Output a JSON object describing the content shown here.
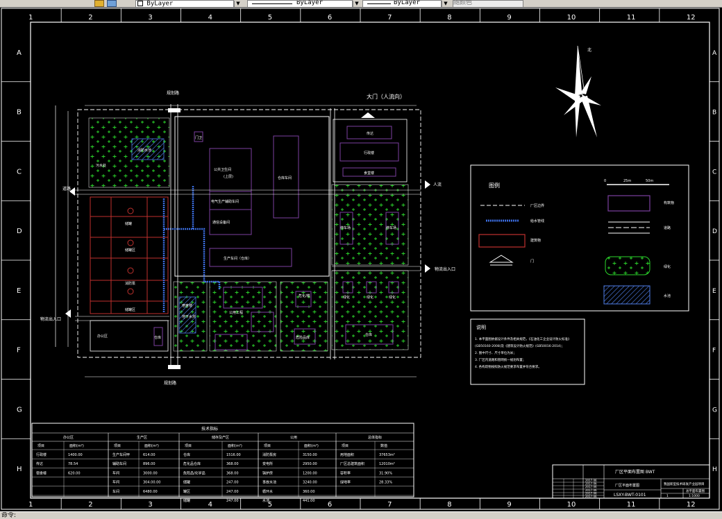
{
  "toolbar": {
    "layer_dropdown_value": "ByLayer",
    "linetype_dropdown_value": "ByLayer",
    "lineweight_dropdown_value": "ByLayer",
    "plotstyle_dropdown_value": "随颜色"
  },
  "frame": {
    "column_labels": [
      "1",
      "2",
      "3",
      "4",
      "5",
      "6",
      "7",
      "8",
      "9",
      "10",
      "11",
      "12"
    ],
    "row_labels": [
      "A",
      "B",
      "C",
      "D",
      "E",
      "F",
      "G",
      "H"
    ]
  },
  "plan": {
    "main_gate_label": "大门（人流向）",
    "north_label": "北",
    "room_labels": {
      "top_left_label": "污水处",
      "pond_label": "消防水池",
      "cinema_label": "公共卫生间",
      "cinema_sub": "(上层)",
      "office1": "电气生产辅助车间",
      "office2": "通信设备间",
      "vertical_block": "仓库车间",
      "hallway": "生产车间（仓库）",
      "center_low": "公用工程",
      "right_top_1": "传达",
      "right_top_2": "行政楼",
      "right_top_3": "食堂楼",
      "right_mid_1": "停车场",
      "right_mid_2": "停车场",
      "right_bottom": "仓库",
      "right_bottom_small": "环保",
      "bottom_mid_label": "危化/楼",
      "bottom_mid_label2": "危险品库",
      "left_bottom_block": "地下水井",
      "left_bottom_room": "宿舍楼",
      "lower_left_room": "办公区",
      "lower_left_small": "仓库",
      "tank1": "储罐",
      "tank2": "储罐区",
      "tank3": "消防泵",
      "tank4": "储罐区",
      "small_box": "门卫",
      "right_mid_small_1": "绿化",
      "right_mid_small_2": "绿化",
      "right_mid_small_3": "绿化"
    },
    "road_labels": {
      "top_road": "规划路",
      "right_road_1": "人流",
      "right_road_2": "物流出入口",
      "left_road": "物流出入口",
      "bottom_road": "规划路",
      "left_vertical": "道路"
    }
  },
  "legend": {
    "title": "图例",
    "scale_labels": [
      "0",
      "25m",
      "50m"
    ],
    "items": [
      {
        "label": "厂区边界"
      },
      {
        "label": "给水管线"
      },
      {
        "label": "建筑物"
      },
      {
        "label": "门"
      },
      {
        "label": "构筑物"
      },
      {
        "label": "道路"
      },
      {
        "label": "绿化"
      },
      {
        "label": "水池"
      }
    ]
  },
  "notes": {
    "title": "说明",
    "lines": [
      "1. 本平面图依据设计条件及相关规范，《石油化工企业设计防火标准》",
      "(GB50160-2008)及《建筑设计防火规范》(GB50016-2014)；",
      "2. 图中尺寸、尺寸单位为米；",
      "3. 厂区内道路和管网统一规划布置；",
      "4. 各构筑物按照防火规范要求布置并符合要求。"
    ]
  },
  "table": {
    "title": "技术指标",
    "groups": [
      "办公区",
      "生产区",
      "储存及产区",
      "公用",
      "总体指标"
    ],
    "headers": [
      "项目",
      "面积(m²)",
      "项目",
      "面积(m²)",
      "项目",
      "面积(m²)",
      "项目",
      "面积(m²)",
      "项目",
      "数值"
    ],
    "rows": [
      [
        "行政楼",
        "1400.00",
        "生产车间甲",
        "614.00",
        "仓库",
        "1516.00",
        "消防泵房",
        "3150.00",
        "用地面积",
        "37653m²"
      ],
      [
        "传达",
        "78.54",
        "辅助车间",
        "896.00",
        "危化品仓库",
        "368.00",
        "变电所",
        "2950.00",
        "厂区总建筑面积",
        "12010m²"
      ],
      [
        "宿舍楼",
        "620.00",
        "车间",
        "3000.00",
        "危险品/化学品",
        "368.00",
        "锅炉房",
        "1200.00",
        "容积率",
        "31.90%"
      ],
      [
        "",
        "",
        "车间",
        "304.00.00",
        "储罐",
        "247.00",
        "事故水池",
        "3240.00",
        "绿地率",
        "28.33%"
      ],
      [
        "",
        "",
        "车间",
        "6480.00",
        "罐区",
        "247.00",
        "循环水",
        "360.00",
        "",
        ""
      ],
      [
        "",
        "",
        "",
        "",
        "储罐",
        "247.00",
        "水池",
        "441.00",
        "",
        ""
      ]
    ]
  },
  "title_block": {
    "company": "厂区平面布置图 BWT",
    "drawing_name": "厂区平面布置图",
    "project": "我国新型技术研发产业园项目",
    "drawing_no": "LSXY-BWT-0101",
    "date_values": [
      "2017.06",
      "2017.06",
      "2017.06",
      "2017.06",
      "2017.06",
      "2017.06"
    ],
    "scale": "1:1000",
    "extra_right": "总平面布置图",
    "sheet": "1"
  },
  "status": {
    "text": "命令:"
  },
  "colors": {
    "background": "#000000",
    "frame": "#ffffff",
    "building": "#7b3fa0",
    "green": "#2bd62b",
    "red_block": "#c0312e",
    "blue_pipe": "#3b6de0"
  }
}
